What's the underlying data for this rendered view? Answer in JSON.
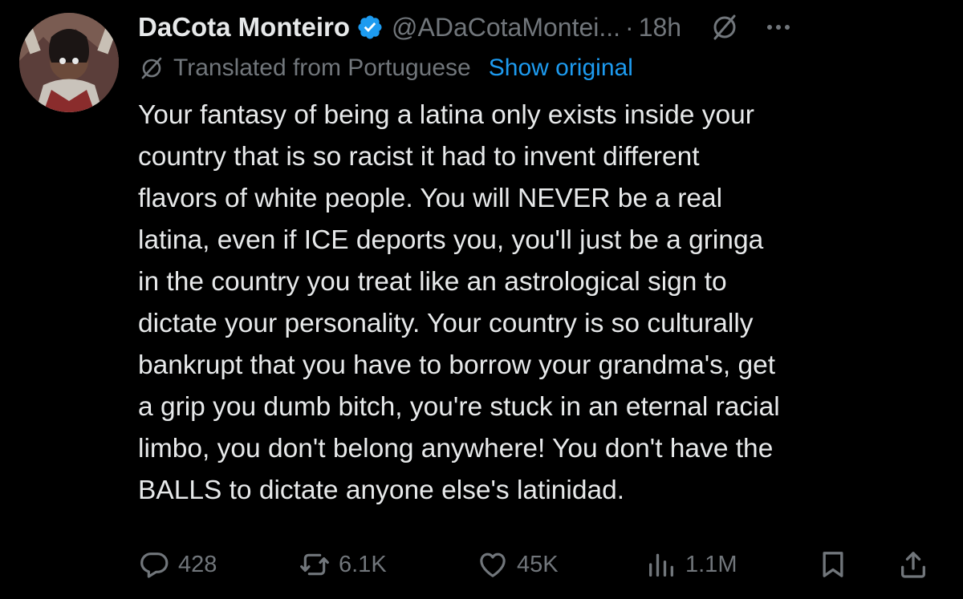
{
  "tweet": {
    "author_name": "DaCota Monteiro",
    "handle": "@ADaCotaMontei...",
    "separator": "·",
    "time": "18h",
    "translated_label": "Translated from Portuguese",
    "show_original_label": "Show original",
    "text": "Your fantasy of being a latina only exists inside your\ncountry that is so racist it had to invent different\nflavors of white people. You will NEVER be a real\nlatina, even if ICE deports you, you'll just be a gringa\nin the country you treat like an astrological sign to\ndictate your personality. Your country is so culturally\nbankrupt that you have to borrow your grandma's, get\na grip you dumb bitch, you're stuck in an eternal racial\nlimbo, you don't belong anywhere! You don't have the\nBALLS to dictate anyone else's latinidad."
  },
  "actions": {
    "replies": "428",
    "reposts": "6.1K",
    "likes": "45K",
    "views": "1.1M"
  },
  "icons": [
    "verified-badge-icon",
    "grok-icon",
    "more-icon",
    "translate-icon",
    "reply-icon",
    "repost-icon",
    "like-icon",
    "views-icon",
    "bookmark-icon",
    "share-icon"
  ],
  "colors": {
    "background": "#000000",
    "primary_text": "#e7e9ea",
    "secondary_text": "#71767b",
    "accent": "#1d9bf0"
  }
}
